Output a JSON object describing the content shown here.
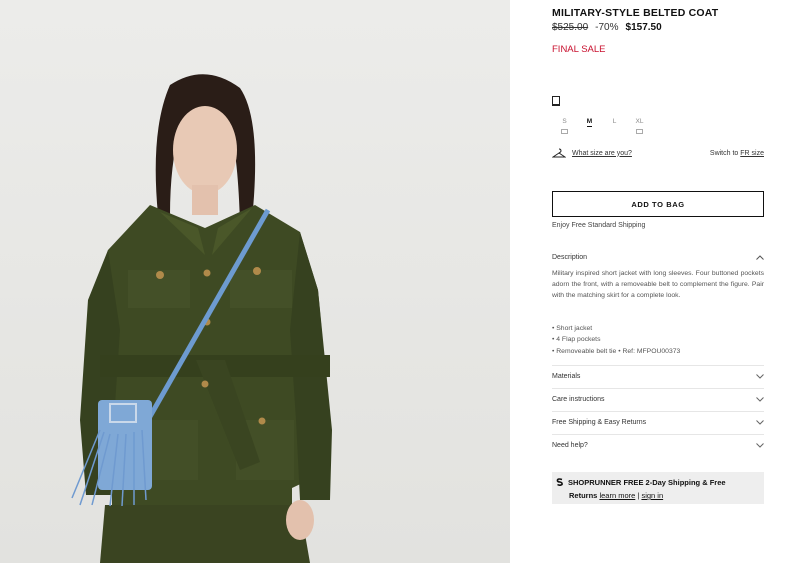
{
  "product": {
    "title": "MILITARY-STYLE BELTED COAT",
    "old_price": "$525.00",
    "discount": "-70%",
    "price": "$157.50",
    "sale_label": "FINAL SALE"
  },
  "sizes": [
    {
      "label": "S",
      "selected": false,
      "notify": true
    },
    {
      "label": "M",
      "selected": true,
      "notify": false
    },
    {
      "label": "L",
      "selected": false,
      "notify": false
    },
    {
      "label": "XL",
      "selected": false,
      "notify": true
    }
  ],
  "size_help": {
    "guide_link": "What size are you?",
    "switch_prefix": "Switch to",
    "switch_link": "FR size"
  },
  "add_to_bag": "ADD TO BAG",
  "shipping_note": "Enjoy Free Standard Shipping",
  "description": {
    "heading": "Description",
    "text": "Military inspired short jacket with long sleeves. Four buttoned pockets adorn the front, with a removeable belt to complement the figure. Pair with the matching skirt for a complete look.",
    "bullets": [
      "• Short jacket",
      "• 4 Flap pockets",
      "• Removeable belt tie • Ref: MFPOU00373"
    ]
  },
  "accordion": [
    "Materials",
    "Care instructions",
    "Free Shipping & Easy Returns",
    "Need help?"
  ],
  "shoprunner": {
    "brand": "SHOPRUNNER",
    "offer": "FREE 2-Day Shipping & Free",
    "line2": "Returns",
    "learn_more": "learn more",
    "sep": "|",
    "sign_in": "sign in"
  },
  "colors": {
    "sale": "#c8102e",
    "coat": "#3e4a23",
    "bag": "#7fa8d6"
  }
}
